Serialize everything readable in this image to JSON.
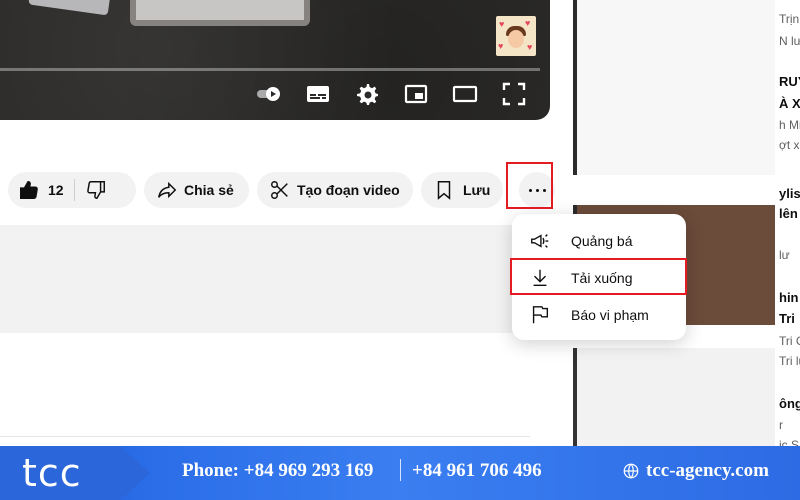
{
  "actions": {
    "like_count": "12",
    "share_label": "Chia sẻ",
    "clip_label": "Tạo đoạn video",
    "save_label": "Lưu"
  },
  "menu": {
    "items": [
      {
        "label": "Quảng bá",
        "icon": "megaphone-icon"
      },
      {
        "label": "Tải xuống",
        "icon": "download-icon"
      },
      {
        "label": "Báo vi phạm",
        "icon": "flag-icon"
      }
    ]
  },
  "sidebar": {
    "texts": [
      "Trịn",
      "N lư",
      "RUYỆ",
      "À XA",
      "h Mi",
      "ợt xe",
      "ylis",
      "lên",
      "lư",
      "hin",
      "Tri",
      "Tri C",
      "Tri lư",
      "ông",
      "r",
      "ic S"
    ]
  },
  "banner": {
    "logo": "tcc",
    "phone1": "Phone: +84 969 293 169",
    "phone2": "+84 961 706 496",
    "website": "tcc-agency.com"
  },
  "colors": {
    "highlight": "#e41b23",
    "banner": "#2b6ee8",
    "pill_bg": "#f2f2f2"
  }
}
